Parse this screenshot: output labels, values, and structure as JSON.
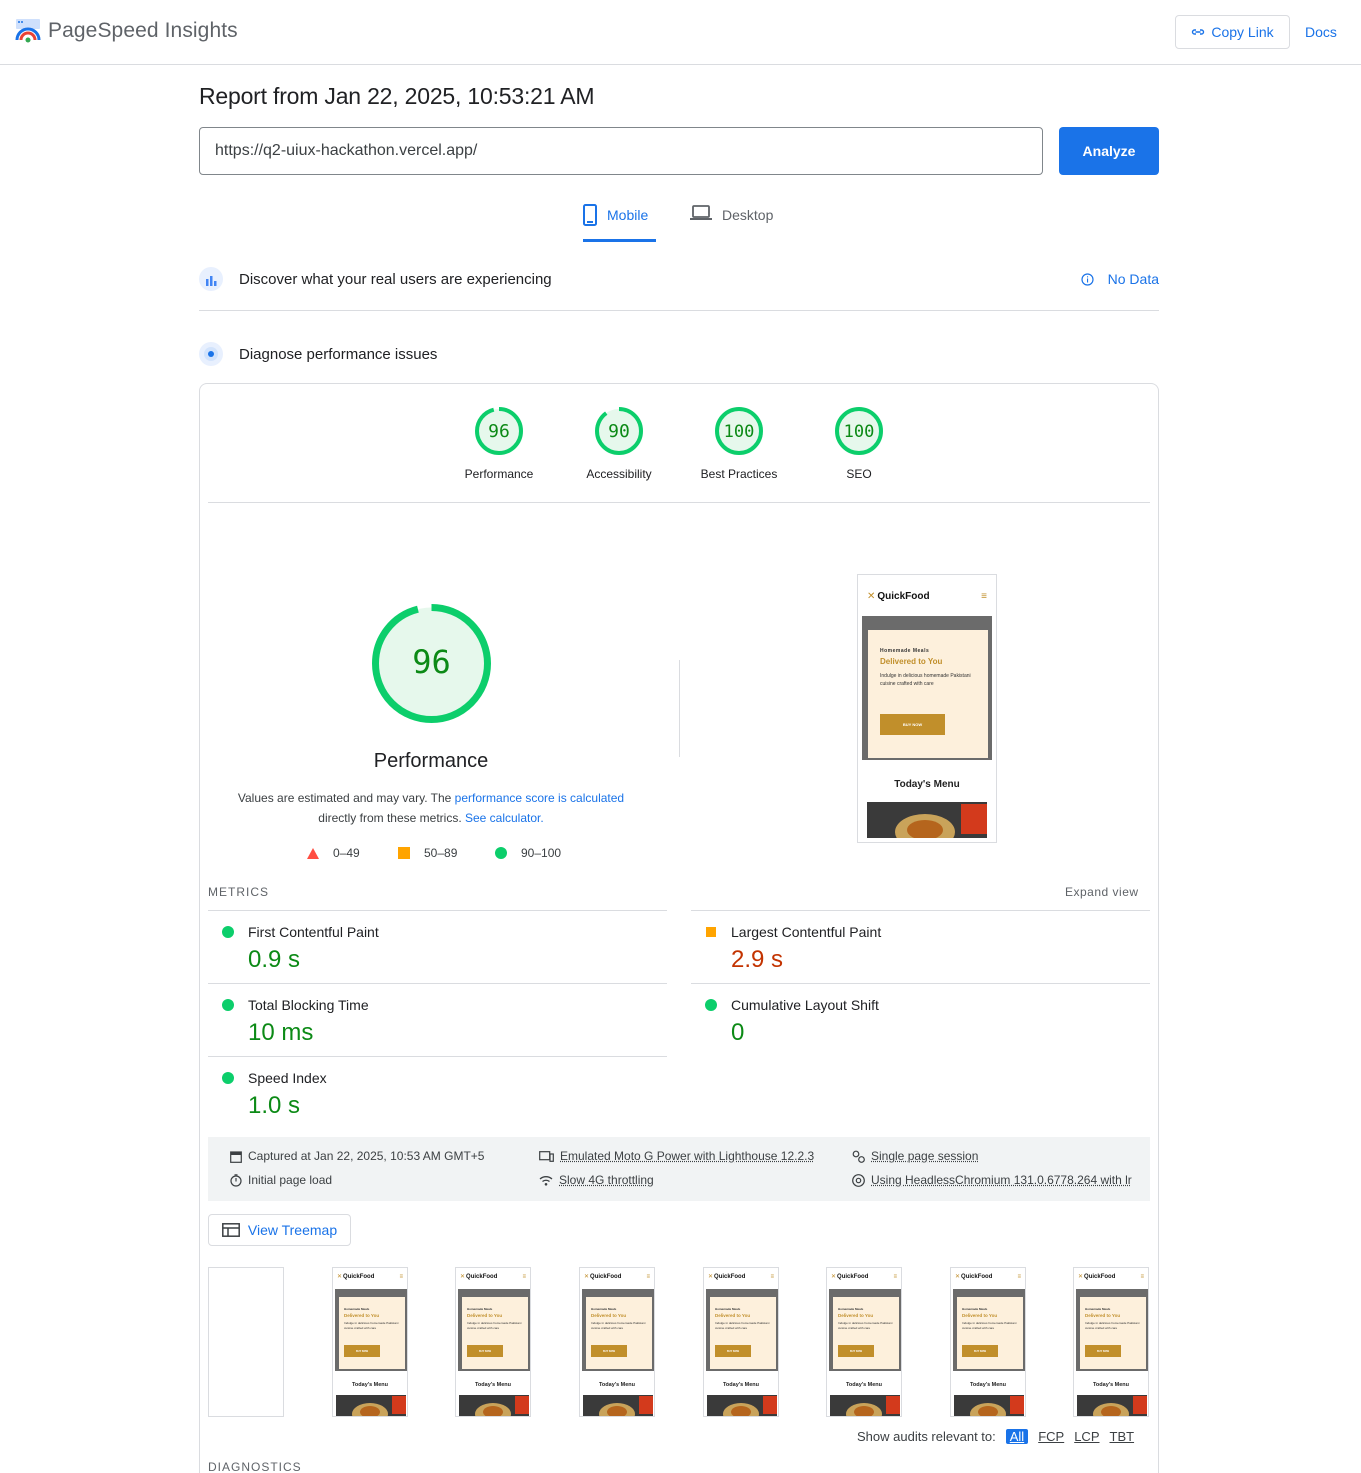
{
  "header": {
    "brand": "PageSpeed Insights",
    "copy_link": "Copy Link",
    "docs": "Docs"
  },
  "report": {
    "title": "Report from Jan 22, 2025, 10:53:21 AM",
    "url_value": "https://q2-uiux-hackathon.vercel.app/",
    "analyze": "Analyze"
  },
  "tabs": {
    "mobile": "Mobile",
    "desktop": "Desktop"
  },
  "field_data": {
    "label": "Discover what your real users are experiencing",
    "status": "No Data"
  },
  "lab": {
    "label": "Diagnose performance issues"
  },
  "scores": [
    {
      "label": "Performance",
      "value": "96",
      "fraction": 0.96
    },
    {
      "label": "Accessibility",
      "value": "90",
      "fraction": 0.9
    },
    {
      "label": "Best Practices",
      "value": "100",
      "fraction": 1.0
    },
    {
      "label": "SEO",
      "value": "100",
      "fraction": 1.0
    }
  ],
  "performance": {
    "score": "96",
    "title": "Performance",
    "note_prefix": "Values are estimated and may vary. The ",
    "note_link1": "performance score is calculated",
    "note_mid": " directly from these metrics. ",
    "note_link2": "See calculator.",
    "legend": [
      "0–49",
      "50–89",
      "90–100"
    ]
  },
  "preview": {
    "brand": "QuickFood",
    "kicker": "Homemade Meals",
    "headline": "Delivered to You",
    "body": "Indulge in delicious homemade Pakistani cuisine crafted with care",
    "button": "BUY NOW",
    "menu": "Today's Menu"
  },
  "metrics": {
    "label": "METRICS",
    "expand": "Expand view",
    "fcp_name": "First Contentful Paint",
    "fcp_value": "0.9 s",
    "lcp_name": "Largest Contentful Paint",
    "lcp_value": "2.9 s",
    "tbt_name": "Total Blocking Time",
    "tbt_value": "10 ms",
    "cls_name": "Cumulative Layout Shift",
    "cls_value": "0",
    "si_name": "Speed Index",
    "si_value": "1.0 s"
  },
  "environment": {
    "captured": "Captured at Jan 22, 2025, 10:53 AM GMT+5",
    "load": "Initial page load",
    "device": "Emulated Moto G Power with Lighthouse 12.2.3",
    "throttle": "Slow 4G throttling",
    "session": "Single page session",
    "browser": "Using HeadlessChromium 131.0.6778.264 with lr"
  },
  "treemap": "View Treemap",
  "audits": {
    "label": "Show audits relevant to:",
    "all": "All",
    "fcp": "FCP",
    "lcp": "LCP",
    "tbt": "TBT"
  },
  "diagnostics": "DIAGNOSTICS",
  "colors": {
    "accent": "#1a73e8",
    "good": "#0cce6b",
    "good_text": "#0c8a16",
    "average": "#ffa400",
    "poor": "#ff4e42",
    "poor_text": "#c33300"
  }
}
